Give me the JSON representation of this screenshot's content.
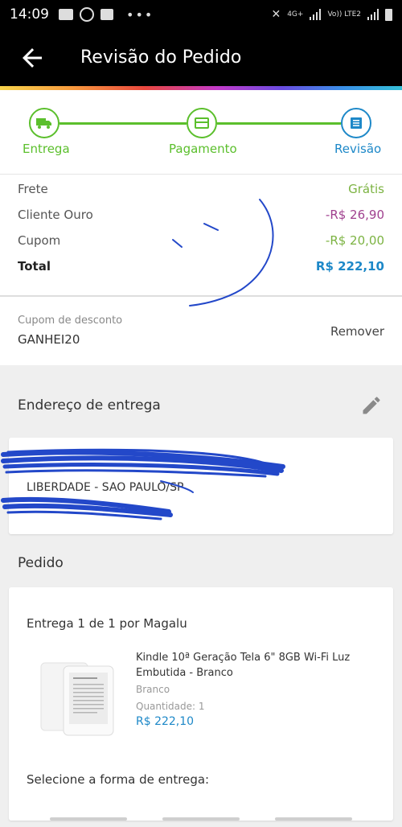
{
  "status_bar": {
    "time": "14:09",
    "network": "4G+",
    "volte": "Vo)) LTE2"
  },
  "header": {
    "title": "Revisão do Pedido"
  },
  "stepper": {
    "steps": [
      {
        "label": "Entrega",
        "state": "done"
      },
      {
        "label": "Pagamento",
        "state": "done"
      },
      {
        "label": "Revisão",
        "state": "active"
      }
    ]
  },
  "summary": {
    "rows": [
      {
        "label": "Frete",
        "value": "Grátis"
      },
      {
        "label": "Cliente Ouro",
        "value": "-R$ 26,90"
      },
      {
        "label": "Cupom",
        "value": "-R$ 20,00"
      },
      {
        "label": "Total",
        "value": "R$ 222,10"
      }
    ]
  },
  "coupon": {
    "label": "Cupom de desconto",
    "code": "GANHEI20",
    "remove_label": "Remover"
  },
  "address": {
    "section_title": "Endereço de entrega",
    "city_line": "LIBERDADE - SAO PAULO/SP"
  },
  "order": {
    "section_title": "Pedido",
    "seller_line": "Entrega 1 de 1 por Magalu",
    "product": {
      "name": "Kindle 10ª Geração Tela 6\" 8GB Wi-Fi Luz Embutida - Branco",
      "color": "Branco",
      "quantity": "Quantidade: 1",
      "price": "R$ 222,10"
    },
    "shipping_prompt": "Selecione a forma de entrega:"
  },
  "colors": {
    "green": "#5bbf2c",
    "blue": "#1d88c8",
    "purple": "#a0418f",
    "header_bg": "#000000"
  }
}
